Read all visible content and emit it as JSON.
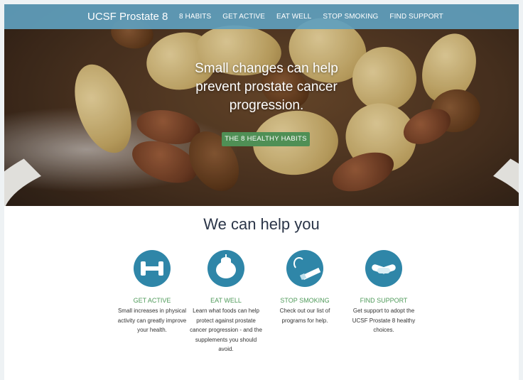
{
  "nav": {
    "brand": "UCSF Prostate 8",
    "links": [
      "8 HABITS",
      "GET ACTIVE",
      "EAT WELL",
      "STOP SMOKING",
      "FIND SUPPORT"
    ]
  },
  "hero": {
    "headline": "Small changes can help prevent prostate cancer progression.",
    "cta_label": "THE 8 HEALTHY HABITS"
  },
  "help": {
    "title": "We can help you",
    "features": [
      {
        "icon": "dumbbell-icon",
        "heading": "GET ACTIVE",
        "text": "Small increases in physical activity can greatly improve your health."
      },
      {
        "icon": "tomato-icon",
        "heading": "EAT WELL",
        "text": "Learn what foods can help protect against prostate cancer progression - and the supplements you should avoid."
      },
      {
        "icon": "cigarette-icon",
        "heading": "STOP SMOKING",
        "text": "Check out our list of programs for help."
      },
      {
        "icon": "handshake-icon",
        "heading": "FIND SUPPORT",
        "text": "Get support to adopt the UCSF Prostate 8 healthy choices."
      }
    ]
  },
  "colors": {
    "nav_bg": "#5fa0be",
    "cta_bg": "#4f8f55",
    "icon_bg": "#2f86a8",
    "feature_heading": "#4f9a5a",
    "title_text": "#2b3548"
  }
}
